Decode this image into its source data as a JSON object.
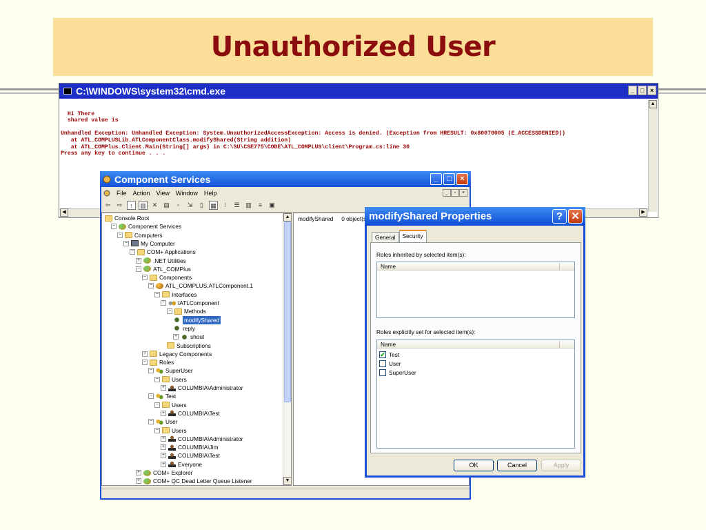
{
  "slide": {
    "title": "Unauthorized User"
  },
  "cmd": {
    "title": "C:\\WINDOWS\\system32\\cmd.exe",
    "lines": [
      "",
      "  Hi There",
      "  shared value is",
      "",
      "Unhandled Exception: Unhandled Exception: System.UnauthorizedAccessException: Access is denied. (Exception from HRESULT: 0x80070005 (E_ACCESSDENIED))",
      "   at ATL_COMPLUSLib.ATLComponentClass.modifyShared(String addition)",
      "   at ATL_COMPlus.Client.Main(String[] args) in C:\\SU\\CSE775\\CODE\\ATL_COMPLUS\\client\\Program.cs:line 30",
      "Press any key to continue . . ."
    ]
  },
  "cs": {
    "title": "Component Services",
    "menu": [
      "File",
      "Action",
      "View",
      "Window",
      "Help"
    ],
    "tree": [
      {
        "label": "Console Root",
        "icon": "folder-icon",
        "pm": ""
      },
      {
        "label": "Component Services",
        "icon": "app-icon",
        "pm": "−"
      },
      {
        "label": "Computers",
        "icon": "folder-icon",
        "pm": "−"
      },
      {
        "label": "My Computer",
        "icon": "computer-icon",
        "pm": "−"
      },
      {
        "label": "COM+ Applications",
        "icon": "folder-icon",
        "pm": "−"
      },
      {
        "label": ".NET Utilities",
        "icon": "app-icon",
        "pm": "+"
      },
      {
        "label": "ATL_COMPlus",
        "icon": "app-icon",
        "pm": "−"
      },
      {
        "label": "Components",
        "icon": "folder-icon",
        "pm": "−"
      },
      {
        "label": "ATL_COMPLUS.ATLComponent.1",
        "icon": "component-icon",
        "pm": "−"
      },
      {
        "label": "Interfaces",
        "icon": "folder-icon",
        "pm": "−"
      },
      {
        "label": "IATLComponent",
        "icon": "interface-icon",
        "pm": "−"
      },
      {
        "label": "Methods",
        "icon": "folder-icon",
        "pm": "−"
      },
      {
        "label": "modifyShared",
        "icon": "method-icon",
        "pm": "",
        "selected": true
      },
      {
        "label": "reply",
        "icon": "method-icon",
        "pm": ""
      },
      {
        "label": "shout",
        "icon": "method-icon",
        "pm": "+"
      },
      {
        "label": "Subscriptions",
        "icon": "folder-icon",
        "pm": ""
      },
      {
        "label": "Legacy Components",
        "icon": "folder-icon",
        "pm": "+"
      },
      {
        "label": "Roles",
        "icon": "folder-icon",
        "pm": "−"
      },
      {
        "label": "SuperUser",
        "icon": "role-icon",
        "pm": "−"
      },
      {
        "label": "Users",
        "icon": "folder-icon",
        "pm": "−"
      },
      {
        "label": "COLUMBIA\\Administrator",
        "icon": "user-icon",
        "pm": "+"
      },
      {
        "label": "Test",
        "icon": "role-icon",
        "pm": "−"
      },
      {
        "label": "Users",
        "icon": "folder-icon",
        "pm": "−"
      },
      {
        "label": "COLUMBIA\\Test",
        "icon": "user-icon",
        "pm": "+"
      },
      {
        "label": "User",
        "icon": "role-icon",
        "pm": "−"
      },
      {
        "label": "Users",
        "icon": "folder-icon",
        "pm": "−"
      },
      {
        "label": "COLUMBIA\\Administrator",
        "icon": "user-icon",
        "pm": "+"
      },
      {
        "label": "COLUMBIA\\Jim",
        "icon": "user-icon",
        "pm": "+"
      },
      {
        "label": "COLUMBIA\\Test",
        "icon": "user-icon",
        "pm": "+"
      },
      {
        "label": "Everyone",
        "icon": "user-icon",
        "pm": "+"
      },
      {
        "label": "COM+ Explorer",
        "icon": "app-icon",
        "pm": "+"
      },
      {
        "label": "COM+ QC Dead Letter Queue Listener",
        "icon": "app-icon",
        "pm": "+"
      }
    ],
    "right_header": {
      "name": "modifyShared",
      "count": "0 object(s)"
    }
  },
  "dialog": {
    "title": "modifyShared Properties",
    "tabs": [
      "General",
      "Security"
    ],
    "active_tab": "Security",
    "inherited_label": "Roles inherited by selected item(s):",
    "inherited_col": "Name",
    "explicit_label": "Roles explicitly set for selected item(s):",
    "explicit_col": "Name",
    "roles": [
      {
        "name": "Test",
        "checked": true
      },
      {
        "name": "User",
        "checked": false
      },
      {
        "name": "SuperUser",
        "checked": false
      }
    ],
    "ok": "OK",
    "cancel": "Cancel",
    "apply": "Apply"
  }
}
